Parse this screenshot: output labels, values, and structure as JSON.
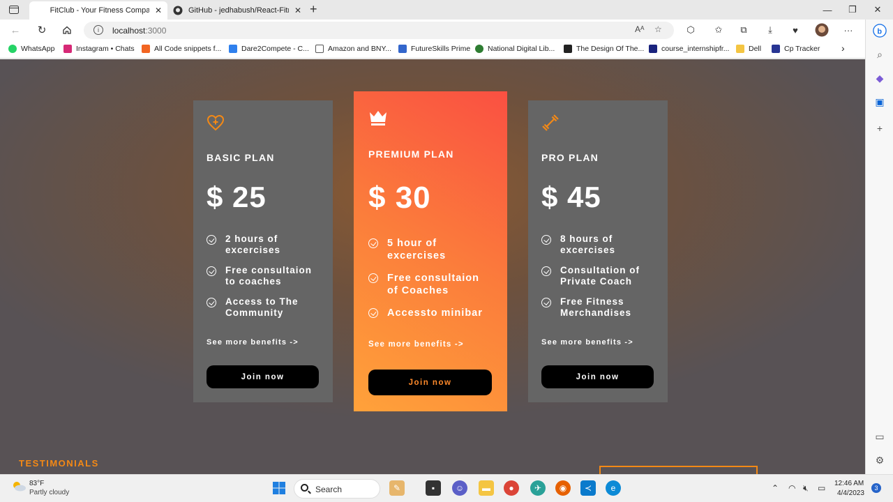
{
  "browser": {
    "tabs": [
      {
        "title": "FitClub - Your Fitness Companion",
        "active": true
      },
      {
        "title": "GitHub - jedhabush/React-Fitness",
        "active": false
      }
    ],
    "url_host": "localhost",
    "url_port": ":3000",
    "bookmarks": [
      {
        "label": "WhatsApp",
        "color": "#25d366"
      },
      {
        "label": "Instagram • Chats",
        "color": "#d62976"
      },
      {
        "label": "All Code snippets f...",
        "color": "#f26522"
      },
      {
        "label": "Dare2Compete - C...",
        "color": "#2f80ed"
      },
      {
        "label": "Amazon and BNY...",
        "color": "#ffffff"
      },
      {
        "label": "FutureSkills Prime",
        "color": "#3366cc"
      },
      {
        "label": "National Digital Lib...",
        "color": "#2e7d32"
      },
      {
        "label": "The Design Of The...",
        "color": "#222222"
      },
      {
        "label": "course_internshipfr...",
        "color": "#1a237e"
      },
      {
        "label": "Dell",
        "color": "#f4c542"
      },
      {
        "label": "Cp Tracker",
        "color": "#283593"
      }
    ]
  },
  "plans": [
    {
      "name": "BASIC PLAN",
      "price": "$ 25",
      "icon": "heart-icon",
      "features": [
        "2 hours of excercises",
        "Free consultaion to coaches",
        "Access to The Community"
      ],
      "benefits": "See more benefits ->",
      "button": "Join now"
    },
    {
      "name": "PREMIUM PLAN",
      "price": "$ 30",
      "icon": "crown-icon",
      "features": [
        "5 hour of excercises",
        "Free consultaion of Coaches",
        "Accessto minibar"
      ],
      "benefits": "See more benefits ->",
      "button": "Join now"
    },
    {
      "name": "PRO PLAN",
      "price": "$ 45",
      "icon": "dumbbell-icon",
      "features": [
        "8 hours of excercises",
        "Consultation of Private Coach",
        "Free Fitness Merchandises"
      ],
      "benefits": "See more benefits ->",
      "button": "Join now"
    }
  ],
  "testimonials_label": "TESTIMONIALS",
  "colors": {
    "accent": "#f48915",
    "card": "#656565",
    "premium_start": "#fa5042",
    "premium_end": "#ffa23a"
  },
  "taskbar": {
    "weather_temp": "83°F",
    "weather_desc": "Partly cloudy",
    "search_label": "Search",
    "time": "12:46 AM",
    "date": "4/4/2023",
    "notifications": "3"
  }
}
